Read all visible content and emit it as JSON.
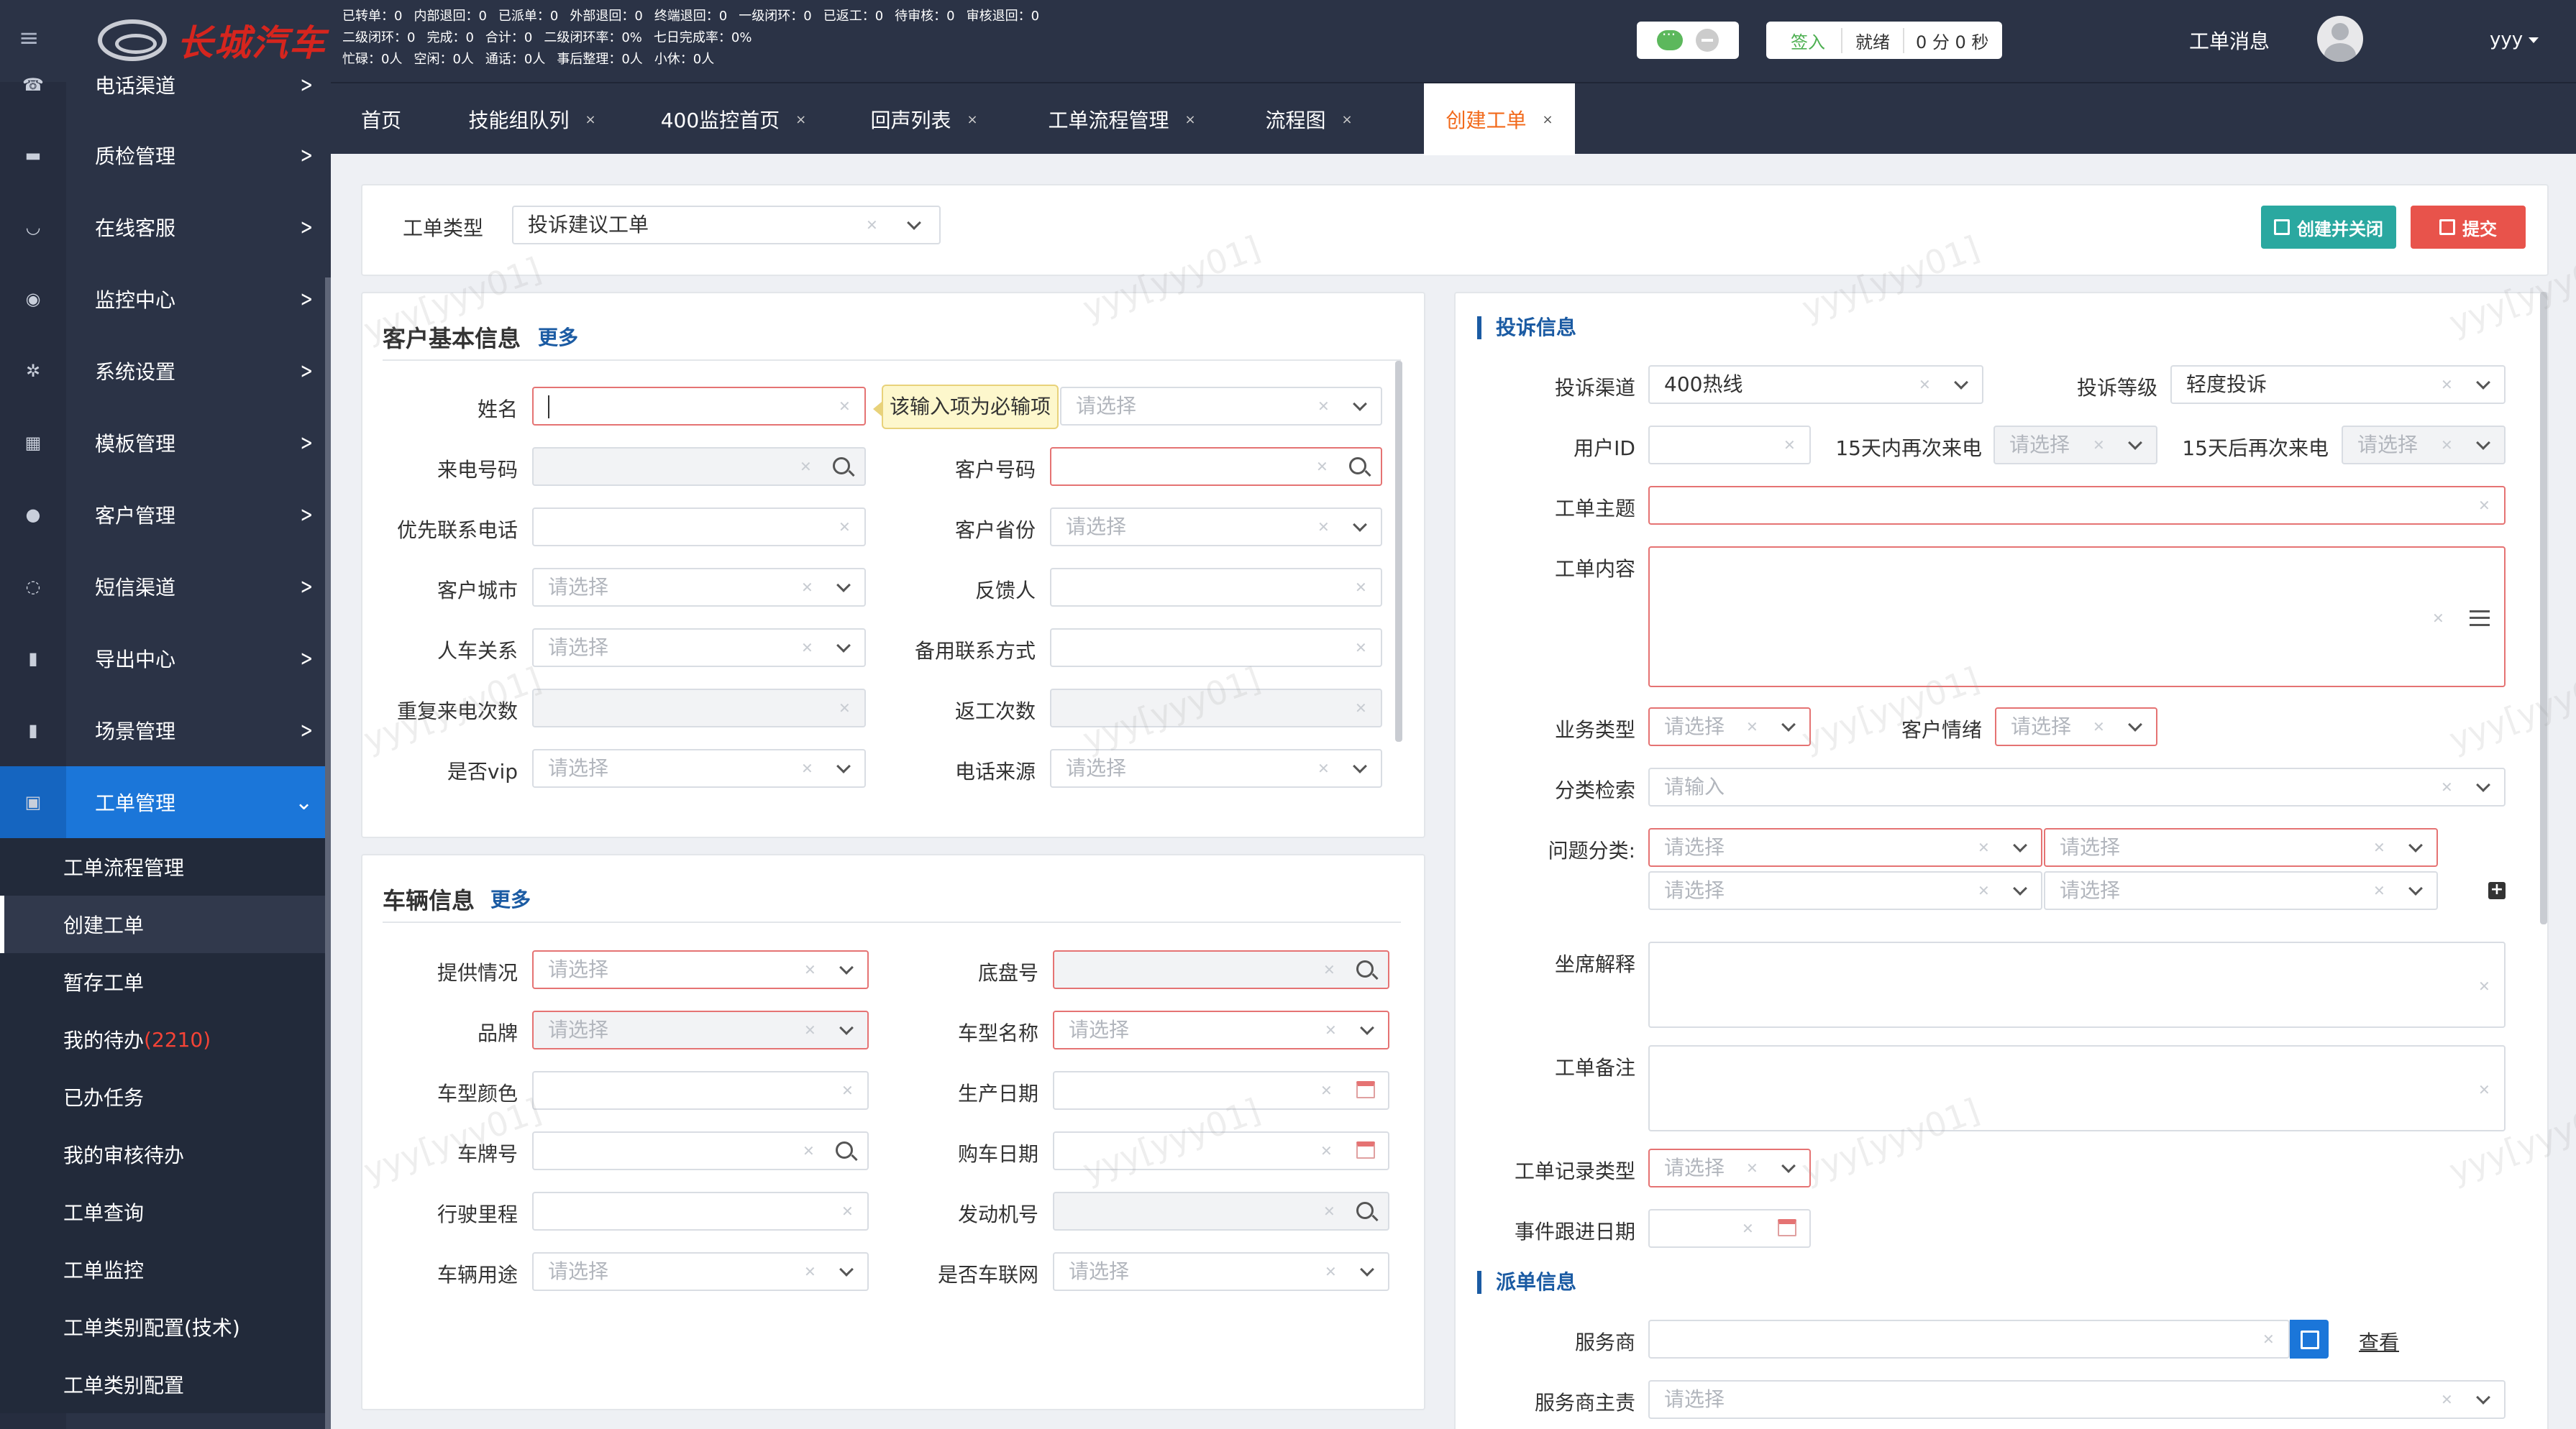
{
  "brand": {
    "logo_text": "长城汽车"
  },
  "stats": {
    "row1": [
      "已转单：0",
      "内部退回：0",
      "已派单：0",
      "外部退回：0",
      "终端退回：0",
      "一级闭环：0",
      "已返工：0",
      "待审核：0",
      "审核退回：0"
    ],
    "row2": [
      "二级闭环：0",
      "完成：0",
      "合计：0",
      "二级闭环率：0%",
      "七日完成率：0%"
    ],
    "row3": [
      "忙碌：0人",
      "空闲：0人",
      "通话：0人",
      "事后整理：0人",
      "小休：0人"
    ]
  },
  "status": {
    "sign_in": "签入",
    "ready": "就绪",
    "timer": "0 分 0 秒"
  },
  "header": {
    "messages": "工单消息",
    "user": "yyy"
  },
  "sidebar": {
    "items": [
      {
        "label": "电话渠道",
        "icon": "phone-icon"
      },
      {
        "label": "质检管理",
        "icon": "archive-icon"
      },
      {
        "label": "在线客服",
        "icon": "headset-icon"
      },
      {
        "label": "监控中心",
        "icon": "eye-icon"
      },
      {
        "label": "系统设置",
        "icon": "gears-icon"
      },
      {
        "label": "模板管理",
        "icon": "grid-icon"
      },
      {
        "label": "客户管理",
        "icon": "user-circle-icon"
      },
      {
        "label": "短信渠道",
        "icon": "chat-icon"
      },
      {
        "label": "导出中心",
        "icon": "book-icon"
      },
      {
        "label": "场景管理",
        "icon": "book-icon"
      },
      {
        "label": "工单管理",
        "icon": "copy-icon"
      }
    ],
    "sub": [
      {
        "label": "工单流程管理"
      },
      {
        "label": "创建工单"
      },
      {
        "label": "暂存工单"
      },
      {
        "label": "我的待办",
        "count": "(2210)"
      },
      {
        "label": "已办任务"
      },
      {
        "label": "我的审核待办"
      },
      {
        "label": "工单查询"
      },
      {
        "label": "工单监控"
      },
      {
        "label": "工单类别配置(技术)"
      },
      {
        "label": "工单类别配置"
      }
    ]
  },
  "tabs": [
    "首页",
    "技能组队列",
    "400监控首页",
    "回声列表",
    "工单流程管理",
    "流程图",
    "创建工单"
  ],
  "tab_close": "×",
  "order_type": {
    "label": "工单类型",
    "value": "投诉建议工单"
  },
  "actions": {
    "create_close": "创建并关闭",
    "submit": "提交"
  },
  "customer": {
    "title": "客户基本信息",
    "more": "更多",
    "tooltip": "该输入项为必输项",
    "fields": {
      "name": "姓名",
      "name_select_ph": "请选择",
      "incoming_phone": "来电号码",
      "customer_no": "客户号码",
      "priority_phone": "优先联系电话",
      "province": "客户省份",
      "province_ph": "请选择",
      "city": "客户城市",
      "city_ph": "请选择",
      "feedbacker": "反馈人",
      "relation": "人车关系",
      "relation_ph": "请选择",
      "backup_contact": "备用联系方式",
      "repeat_calls": "重复来电次数",
      "rework_count": "返工次数",
      "vip": "是否vip",
      "vip_ph": "请选择",
      "call_source": "电话来源",
      "call_source_ph": "请选择"
    }
  },
  "vehicle": {
    "title": "车辆信息",
    "more": "更多",
    "fields": {
      "provide": "提供情况",
      "provide_ph": "请选择",
      "chassis": "底盘号",
      "brand": "品牌",
      "brand_ph": "请选择",
      "model": "车型名称",
      "model_ph": "请选择",
      "color": "车型颜色",
      "prod_date": "生产日期",
      "plate": "车牌号",
      "buy_date": "购车日期",
      "mileage": "行驶里程",
      "engine": "发动机号",
      "usage": "车辆用途",
      "usage_ph": "请选择",
      "iov": "是否车联网",
      "iov_ph": "请选择"
    }
  },
  "complaint": {
    "section": "投诉信息",
    "channel": "投诉渠道",
    "channel_value": "400热线",
    "level": "投诉等级",
    "level_value": "轻度投诉",
    "user_id": "用户ID",
    "recall_15": "15天内再次来电",
    "recall_15_ph": "请选择",
    "recall_after_15": "15天后再次来电",
    "recall_after_15_ph": "请选择",
    "subject": "工单主题",
    "content": "工单内容",
    "biz_type": "业务类型",
    "biz_type_ph": "请选择",
    "emotion": "客户情绪",
    "emotion_ph": "请选择",
    "category_search": "分类检索",
    "category_search_ph": "请输入",
    "problem": "问题分类:",
    "problem_ph": "请选择",
    "agent_note": "坐席解释",
    "remark": "工单备注",
    "record_type": "工单记录类型",
    "record_type_ph": "请选择",
    "follow_date": "事件跟进日期"
  },
  "dispatch": {
    "section": "派单信息",
    "provider": "服务商",
    "view": "查看",
    "owner": "服务商主责",
    "owner_ph": "请选择"
  },
  "watermark": "yyy[yyy01]"
}
